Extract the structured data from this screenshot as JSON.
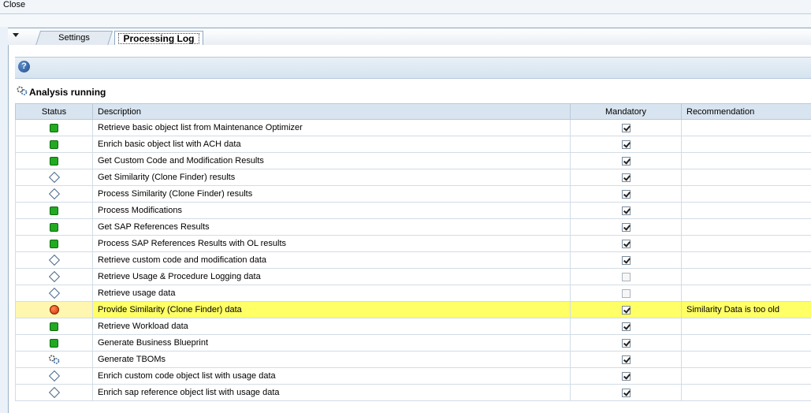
{
  "topbar": {
    "close_label": "Close"
  },
  "tabs": [
    {
      "label": "Settings",
      "active": false
    },
    {
      "label": "Processing Log",
      "active": true
    }
  ],
  "status_title": "Analysis running",
  "columns": {
    "status": "Status",
    "description": "Description",
    "mandatory": "Mandatory",
    "recommendation": "Recommendation"
  },
  "rows": [
    {
      "status": "green",
      "description": "Retrieve basic object list from Maintenance Optimizer",
      "mandatory": true,
      "recommendation": ""
    },
    {
      "status": "green",
      "description": "Enrich basic object list with ACH data",
      "mandatory": true,
      "recommendation": ""
    },
    {
      "status": "green",
      "description": "Get Custom Code and Modification Results",
      "mandatory": true,
      "recommendation": ""
    },
    {
      "status": "diamond",
      "description": "Get Similarity (Clone Finder) results",
      "mandatory": true,
      "recommendation": ""
    },
    {
      "status": "diamond",
      "description": "Process Similarity (Clone Finder) results",
      "mandatory": true,
      "recommendation": ""
    },
    {
      "status": "green",
      "description": "Process Modifications",
      "mandatory": true,
      "recommendation": ""
    },
    {
      "status": "green",
      "description": "Get SAP References Results",
      "mandatory": true,
      "recommendation": ""
    },
    {
      "status": "green",
      "description": "Process SAP References Results with OL results",
      "mandatory": true,
      "recommendation": ""
    },
    {
      "status": "diamond",
      "description": "Retrieve custom code and modification data",
      "mandatory": true,
      "recommendation": ""
    },
    {
      "status": "diamond",
      "description": "Retrieve Usage & Procedure Logging data",
      "mandatory": false,
      "recommendation": ""
    },
    {
      "status": "diamond",
      "description": "Retrieve usage data",
      "mandatory": false,
      "recommendation": ""
    },
    {
      "status": "red",
      "description": "Provide Similarity (Clone Finder) data",
      "mandatory": true,
      "recommendation": "Similarity Data is too old",
      "highlight": true
    },
    {
      "status": "green",
      "description": "Retrieve Workload data",
      "mandatory": true,
      "recommendation": ""
    },
    {
      "status": "green",
      "description": "Generate Business Blueprint",
      "mandatory": true,
      "recommendation": ""
    },
    {
      "status": "running",
      "description": "Generate TBOMs",
      "mandatory": true,
      "recommendation": ""
    },
    {
      "status": "diamond",
      "description": "Enrich custom code object list with usage data",
      "mandatory": true,
      "recommendation": ""
    },
    {
      "status": "diamond",
      "description": "Enrich sap reference object list with usage data",
      "mandatory": true,
      "recommendation": ""
    }
  ],
  "colors": {
    "green": "#22aa22",
    "red": "#d0300a",
    "highlight": "#ffff66",
    "header_bg": "#d8e4f0"
  },
  "icons": {
    "help": "help-icon",
    "running": "gears-icon",
    "green": "status-green-icon",
    "diamond": "status-pending-icon",
    "red": "status-error-icon"
  }
}
